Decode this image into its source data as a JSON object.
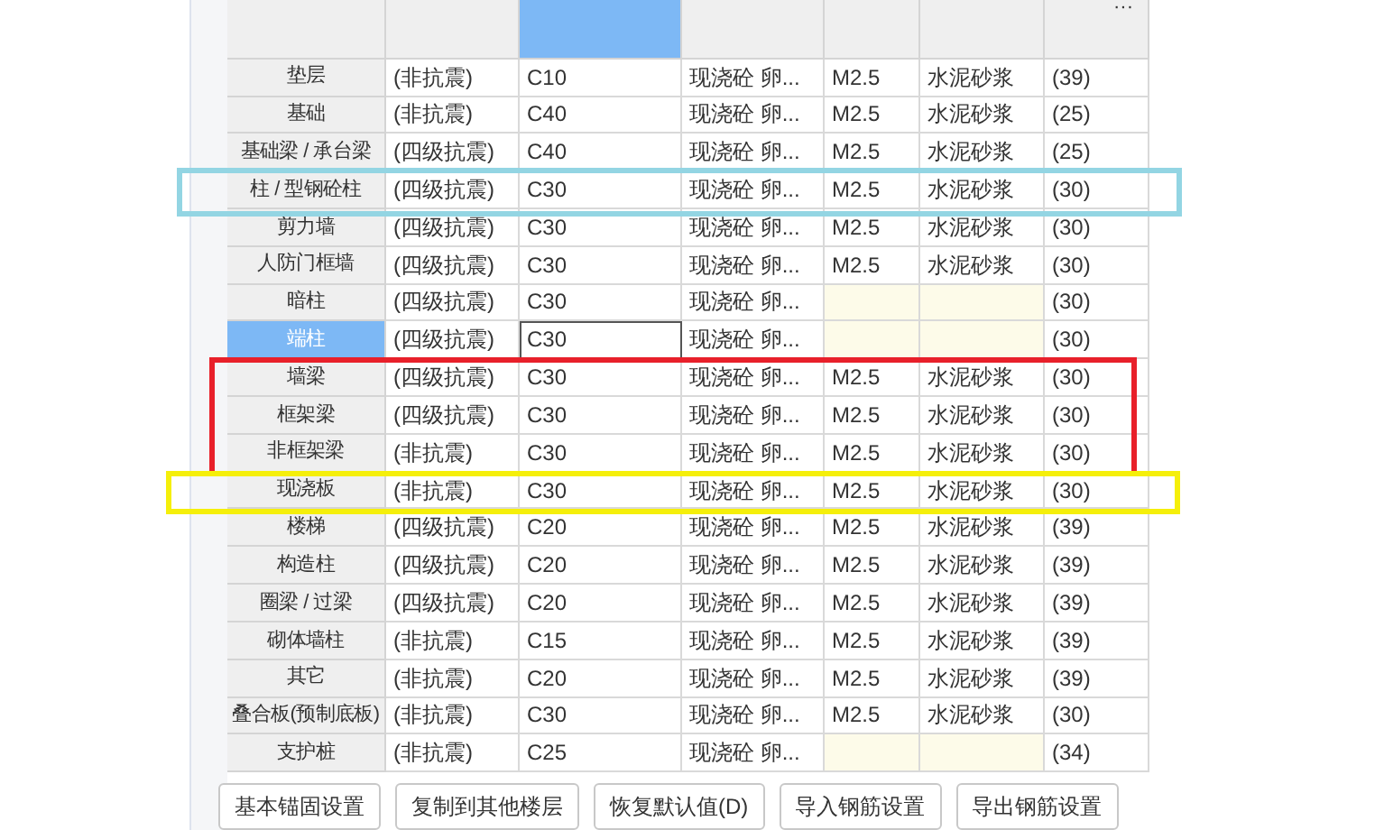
{
  "table": {
    "columns": [
      {
        "selected": false
      },
      {
        "selected": false
      },
      {
        "selected": true
      },
      {
        "selected": false
      },
      {
        "selected": false
      },
      {
        "selected": false
      },
      {
        "selected": false
      }
    ],
    "more": "···",
    "rows": [
      {
        "name": "垫层",
        "seismic": "(非抗震)",
        "grade": "C10",
        "type": "现浇砼 卵...",
        "mortar": "M2.5",
        "mortar_type": "水泥砂浆",
        "code": "(39)",
        "selected": false
      },
      {
        "name": "基础",
        "seismic": "(非抗震)",
        "grade": "C40",
        "type": "现浇砼 卵...",
        "mortar": "M2.5",
        "mortar_type": "水泥砂浆",
        "code": "(25)",
        "selected": false
      },
      {
        "name": "基础梁 / 承台梁",
        "seismic": "(四级抗震)",
        "grade": "C40",
        "type": "现浇砼 卵...",
        "mortar": "M2.5",
        "mortar_type": "水泥砂浆",
        "code": "(25)",
        "selected": false
      },
      {
        "name": "柱 / 型钢砼柱",
        "seismic": "(四级抗震)",
        "grade": "C30",
        "type": "现浇砼 卵...",
        "mortar": "M2.5",
        "mortar_type": "水泥砂浆",
        "code": "(30)",
        "selected": false
      },
      {
        "name": "剪力墙",
        "seismic": "(四级抗震)",
        "grade": "C30",
        "type": "现浇砼 卵...",
        "mortar": "M2.5",
        "mortar_type": "水泥砂浆",
        "code": "(30)",
        "selected": false
      },
      {
        "name": "人防门框墙",
        "seismic": "(四级抗震)",
        "grade": "C30",
        "type": "现浇砼 卵...",
        "mortar": "M2.5",
        "mortar_type": "水泥砂浆",
        "code": "(30)",
        "selected": false
      },
      {
        "name": "暗柱",
        "seismic": "(四级抗震)",
        "grade": "C30",
        "type": "现浇砼 卵...",
        "code": "(30)",
        "selected": false
      },
      {
        "name": "端柱",
        "seismic": "(四级抗震)",
        "grade": "C30",
        "type": "现浇砼 卵...",
        "code": "(30)",
        "selected": true
      },
      {
        "name": "墙梁",
        "seismic": "(四级抗震)",
        "grade": "C30",
        "type": "现浇砼 卵...",
        "mortar": "M2.5",
        "mortar_type": "水泥砂浆",
        "code": "(30)",
        "selected": false
      },
      {
        "name": "框架梁",
        "seismic": "(四级抗震)",
        "grade": "C30",
        "type": "现浇砼 卵...",
        "mortar": "M2.5",
        "mortar_type": "水泥砂浆",
        "code": "(30)",
        "selected": false
      },
      {
        "name": "非框架梁",
        "seismic": "(非抗震)",
        "grade": "C30",
        "type": "现浇砼 卵...",
        "mortar": "M2.5",
        "mortar_type": "水泥砂浆",
        "code": "(30)",
        "selected": false
      },
      {
        "name": "现浇板",
        "seismic": "(非抗震)",
        "grade": "C30",
        "type": "现浇砼 卵...",
        "mortar": "M2.5",
        "mortar_type": "水泥砂浆",
        "code": "(30)",
        "selected": false
      },
      {
        "name": "楼梯",
        "seismic": "(四级抗震)",
        "grade": "C20",
        "type": "现浇砼 卵...",
        "mortar": "M2.5",
        "mortar_type": "水泥砂浆",
        "code": "(39)",
        "selected": false
      },
      {
        "name": "构造柱",
        "seismic": "(四级抗震)",
        "grade": "C20",
        "type": "现浇砼 卵...",
        "mortar": "M2.5",
        "mortar_type": "水泥砂浆",
        "code": "(39)",
        "selected": false
      },
      {
        "name": "圈梁 / 过梁",
        "seismic": "(四级抗震)",
        "grade": "C20",
        "type": "现浇砼 卵...",
        "mortar": "M2.5",
        "mortar_type": "水泥砂浆",
        "code": "(39)",
        "selected": false
      },
      {
        "name": "砌体墙柱",
        "seismic": "(非抗震)",
        "grade": "C15",
        "type": "现浇砼 卵...",
        "mortar": "M2.5",
        "mortar_type": "水泥砂浆",
        "code": "(39)",
        "selected": false
      },
      {
        "name": "其它",
        "seismic": "(非抗震)",
        "grade": "C20",
        "type": "现浇砼 卵...",
        "mortar": "M2.5",
        "mortar_type": "水泥砂浆",
        "code": "(39)",
        "selected": false
      },
      {
        "name": "叠合板(预制底板)",
        "seismic": "(非抗震)",
        "grade": "C30",
        "type": "现浇砼 卵...",
        "mortar": "M2.5",
        "mortar_type": "水泥砂浆",
        "code": "(30)",
        "selected": false
      },
      {
        "name": "支护桩",
        "seismic": "(非抗震)",
        "grade": "C25",
        "type": "现浇砼 卵...",
        "code": "(34)",
        "selected": false
      }
    ]
  },
  "highlights": [
    {
      "color": "#93d5e3"
    },
    {
      "color": "#e8202a"
    },
    {
      "color": "#f5ef0a"
    }
  ],
  "buttons": [
    "基本锚固设置",
    "复制到其他楼层",
    "恢复默认值(D)",
    "导入钢筋设置",
    "导出钢筋设置"
  ]
}
